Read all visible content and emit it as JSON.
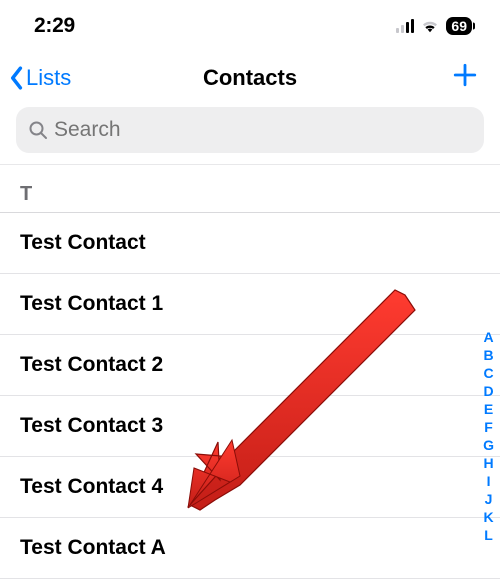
{
  "status": {
    "time": "2:29",
    "battery": "69"
  },
  "nav": {
    "back_label": "Lists",
    "title": "Contacts"
  },
  "search": {
    "placeholder": "Search"
  },
  "section_header": "T",
  "contacts": [
    "Test Contact",
    "Test Contact 1",
    "Test Contact 2",
    "Test Contact 3",
    "Test Contact 4",
    "Test Contact A"
  ],
  "index_letters": [
    "A",
    "B",
    "C",
    "D",
    "E",
    "F",
    "G",
    "H",
    "I",
    "J",
    "K",
    "L"
  ]
}
